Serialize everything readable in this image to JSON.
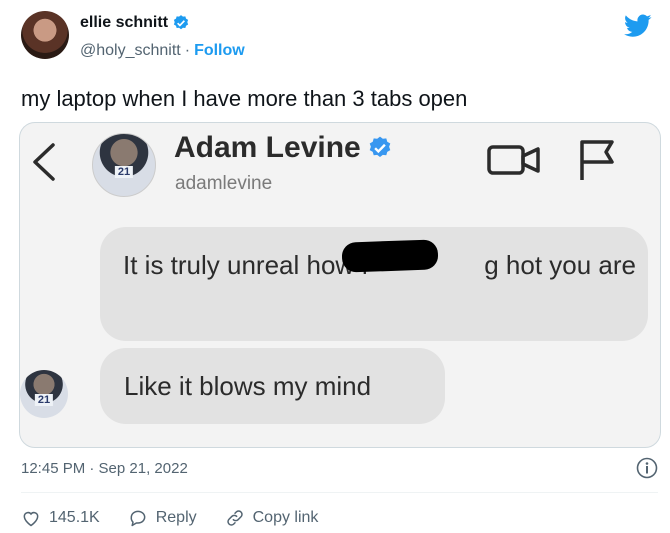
{
  "author": {
    "display_name": "ellie schnitt",
    "handle": "@holy_schnitt",
    "separator": "·",
    "follow_label": "Follow"
  },
  "tweet": {
    "text": "my laptop when I have more than 3 tabs open",
    "timestamp": "12:45 PM · Sep 21, 2022"
  },
  "media": {
    "dm_name": "Adam Levine",
    "dm_handle": "adamlevine",
    "avatar_jersey": "21",
    "messages": [
      "It is truly unreal how f                g hot you are",
      "Like it blows my mind"
    ]
  },
  "actions": {
    "likes": "145.1K",
    "reply_label": "Reply",
    "copy_label": "Copy link"
  },
  "colors": {
    "accent": "#1d9bf0",
    "muted": "#536471",
    "bubble": "#e2e2e2"
  }
}
